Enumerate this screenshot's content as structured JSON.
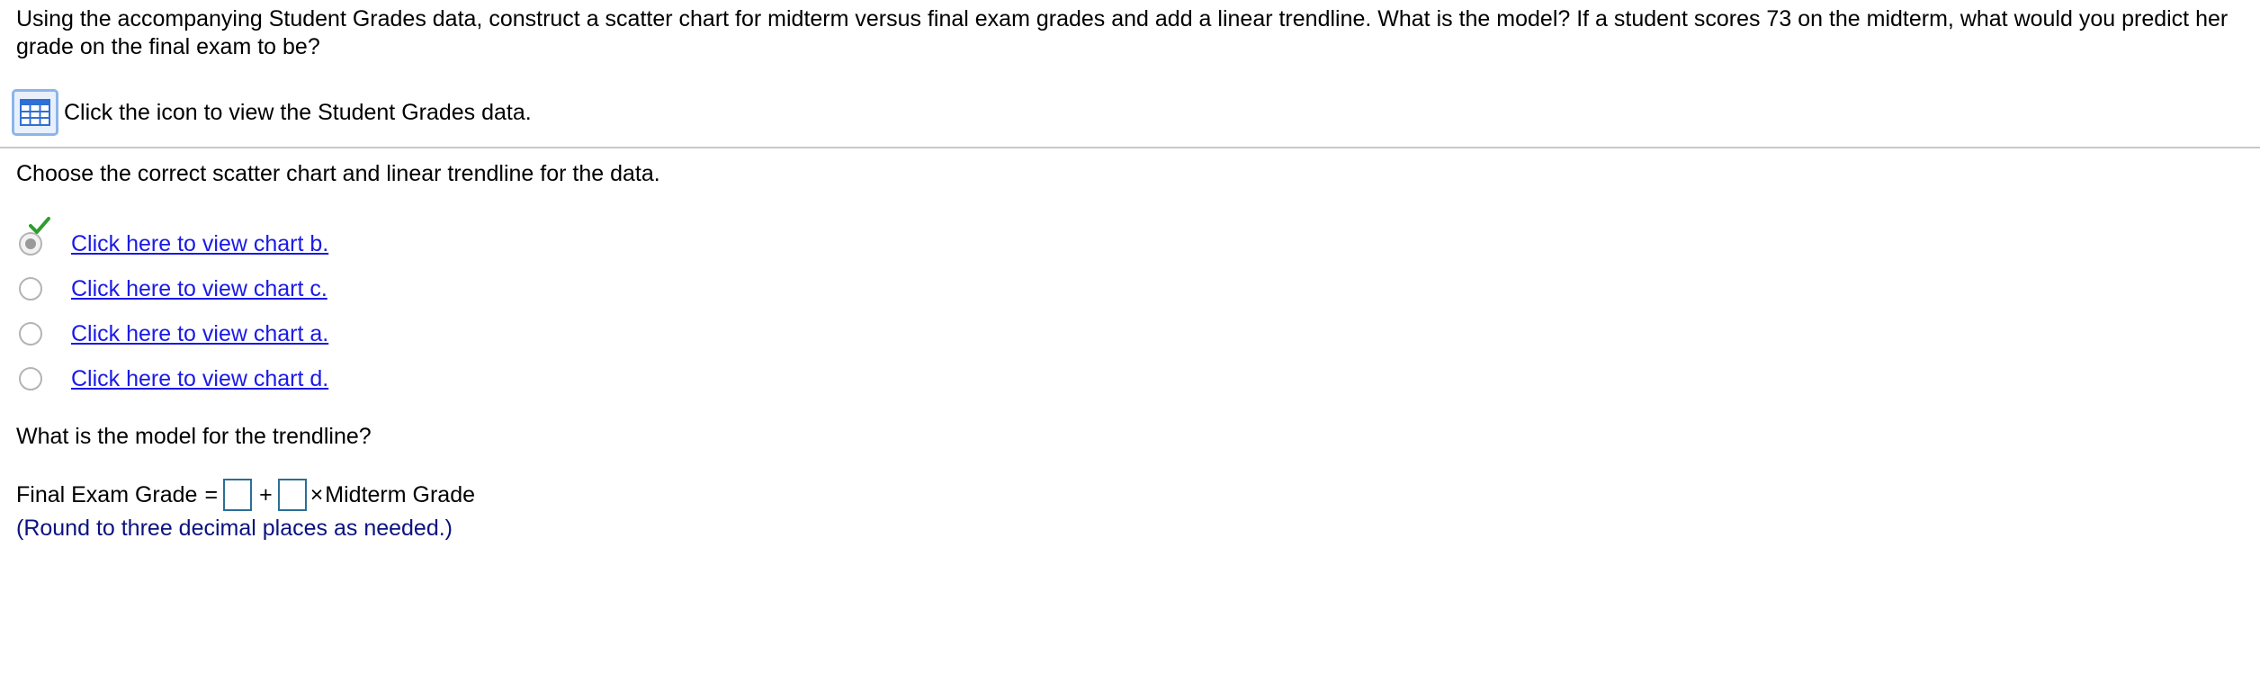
{
  "question": {
    "text": "Using the accompanying Student Grades data, construct a scatter chart for midterm versus final exam grades and add a linear trendline. What is the model? If a student scores 73 on the midterm, what would you predict her grade on the final exam to be?"
  },
  "data_link": {
    "icon": "table-grid-icon",
    "label": "Click the icon to view the Student Grades data."
  },
  "part1": {
    "instruction": "Choose the correct scatter chart and linear trendline for the data.",
    "selected_index": 0,
    "options": [
      {
        "label": "Click here to view chart b.",
        "selected": true
      },
      {
        "label": "Click here to view chart c.",
        "selected": false
      },
      {
        "label": "Click here to view chart a.",
        "selected": false
      },
      {
        "label": "Click here to view chart d.",
        "selected": false
      }
    ]
  },
  "part2": {
    "question": "What is the model for the trendline?",
    "equation": {
      "lhs": "Final Exam Grade",
      "equals": "=",
      "intercept_value": "",
      "plus": "+",
      "slope_value": "",
      "times": "×",
      "rhs": "Midterm Grade"
    },
    "hint": "(Round to three decimal places as needed.)"
  },
  "colors": {
    "link": "#1a1ae6",
    "hint": "#0b1280",
    "input_border": "#2a6f97",
    "check": "#2e9e2e",
    "icon": "#2f6fd6"
  }
}
